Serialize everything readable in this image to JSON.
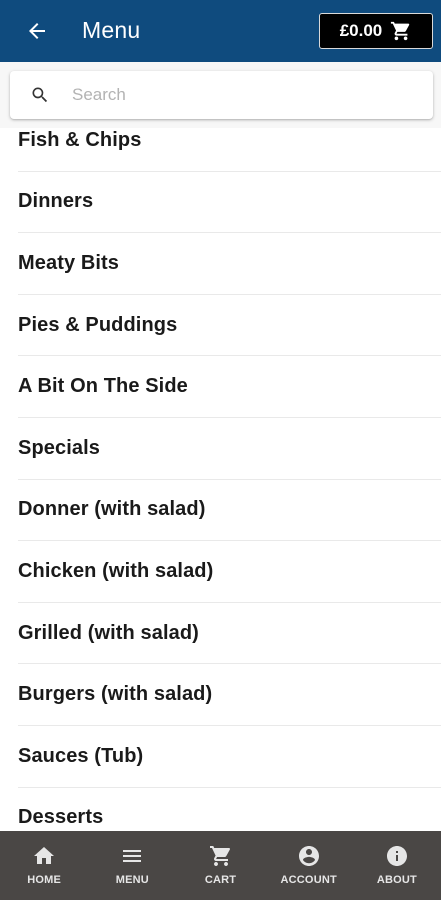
{
  "colors": {
    "appbar": "#0f4b7e",
    "bottom_nav": "#4a4745",
    "cart_button": "#000000",
    "item_text": "#1a1a1a"
  },
  "header": {
    "title": "Menu",
    "back_icon": "arrow-left-icon",
    "cart_amount": "£0.00",
    "cart_icon": "cart-icon"
  },
  "search": {
    "placeholder": "Search",
    "value": "",
    "icon": "search-icon"
  },
  "categories": [
    "Fish & Chips",
    "Dinners",
    "Meaty Bits",
    "Pies & Puddings",
    "A Bit On The Side",
    "Specials",
    "Donner (with salad)",
    "Chicken (with salad)",
    "Grilled (with salad)",
    "Burgers (with salad)",
    "Sauces (Tub)",
    "Desserts"
  ],
  "bottom_nav": [
    {
      "label": "HOME",
      "icon": "home-icon"
    },
    {
      "label": "MENU",
      "icon": "menu-icon"
    },
    {
      "label": "CART",
      "icon": "cart-icon"
    },
    {
      "label": "ACCOUNT",
      "icon": "account-icon"
    },
    {
      "label": "ABOUT",
      "icon": "info-icon"
    }
  ]
}
